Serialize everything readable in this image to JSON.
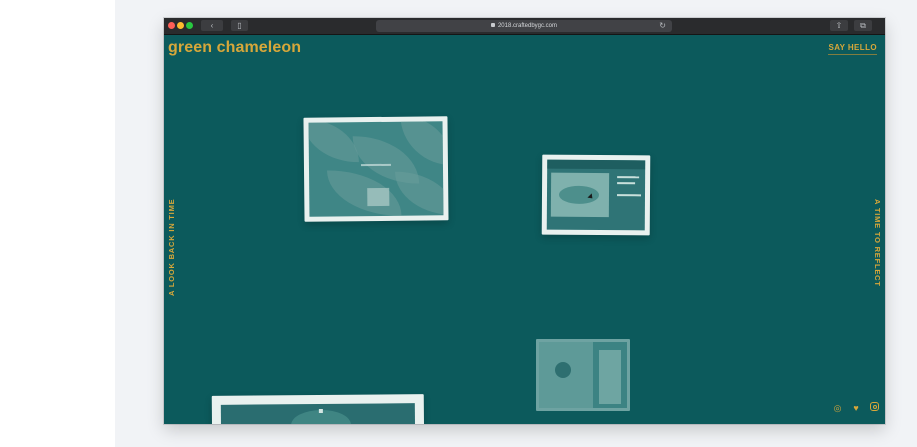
{
  "browser": {
    "url": "2018.craftedbygc.com",
    "back_label": "‹",
    "sidebar_label": "▯",
    "share_label": "⇧",
    "tabs_label": "⧉",
    "reload_label": "↻"
  },
  "site": {
    "logo": "green chameleon",
    "say_hello": "SAY HELLO",
    "left_nav": "A LOOK BACK IN TIME",
    "right_nav": "A TIME TO REFLECT",
    "social": [
      "dribbble-icon",
      "twitter-icon",
      "instagram-icon"
    ]
  },
  "colors": {
    "background": "#0c5a5c",
    "accent": "#d7a73a",
    "card": "#e9f1ef"
  }
}
